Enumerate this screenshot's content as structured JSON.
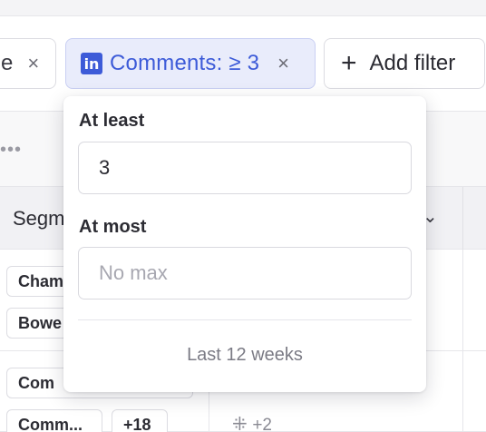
{
  "filters": {
    "previous_chip": {
      "text": "e",
      "close": "×"
    },
    "active_chip": {
      "icon": "linkedin-icon",
      "label": "Comments: ≥ 3",
      "close": "×",
      "accent": "#3d5bd8"
    },
    "add_filter": {
      "plus": "+",
      "label": "Add filter"
    }
  },
  "table": {
    "dots": "•••",
    "header": {
      "col1": "Segm",
      "chevron": "⌄"
    },
    "rows": [
      {
        "tags": [
          "Cham",
          "Bowe"
        ]
      },
      {
        "tags": [
          "Com",
          "Comm...",
          "+18"
        ],
        "icon": "slack-icon",
        "icon_count": "+2"
      }
    ]
  },
  "popup": {
    "min_label": "At least",
    "min_value": "3",
    "max_label": "At most",
    "max_placeholder": "No max",
    "range_text": "Last 12 weeks"
  }
}
